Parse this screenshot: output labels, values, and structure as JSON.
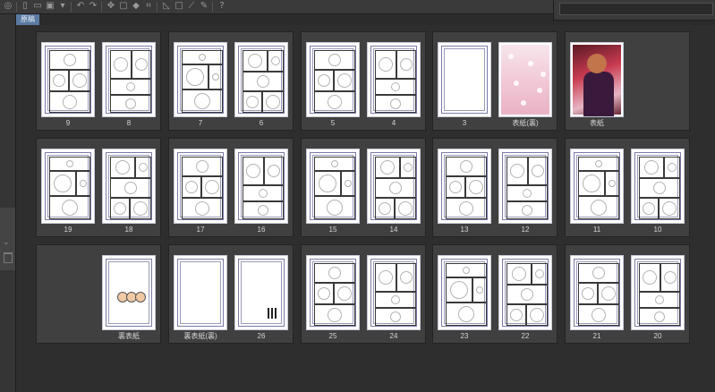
{
  "toolbar": {
    "icons": [
      "app-icon",
      "new-file-icon",
      "open-folder-icon",
      "save-icon",
      "dropdown-icon",
      "undo-icon",
      "redo-icon",
      "transform-icon",
      "clear-icon",
      "fill-icon",
      "crop-icon",
      "ruler-icon",
      "frame-icon",
      "line-icon",
      "pen-icon",
      "help-icon"
    ]
  },
  "document_tab": {
    "label": "原稿"
  },
  "selected_page": "25",
  "rows": [
    [
      {
        "pages": [
          "9",
          "8"
        ]
      },
      {
        "pages": [
          "7",
          "6"
        ]
      },
      {
        "pages": [
          "5",
          "4"
        ]
      },
      {
        "pages": [
          "3",
          "表紙(裏)"
        ]
      },
      {
        "pages": [
          "表紙"
        ]
      }
    ],
    [
      {
        "pages": [
          "19",
          "18"
        ]
      },
      {
        "pages": [
          "17",
          "16"
        ]
      },
      {
        "pages": [
          "15",
          "14"
        ]
      },
      {
        "pages": [
          "13",
          "12"
        ]
      },
      {
        "pages": [
          "11",
          "10"
        ]
      }
    ],
    [
      {
        "pages": [
          "裏表紙"
        ]
      },
      {
        "pages": [
          "裏表紙(裏)",
          "26"
        ]
      },
      {
        "pages": [
          "25",
          "24"
        ]
      },
      {
        "pages": [
          "23",
          "22"
        ]
      },
      {
        "pages": [
          "21",
          "20"
        ]
      }
    ]
  ]
}
